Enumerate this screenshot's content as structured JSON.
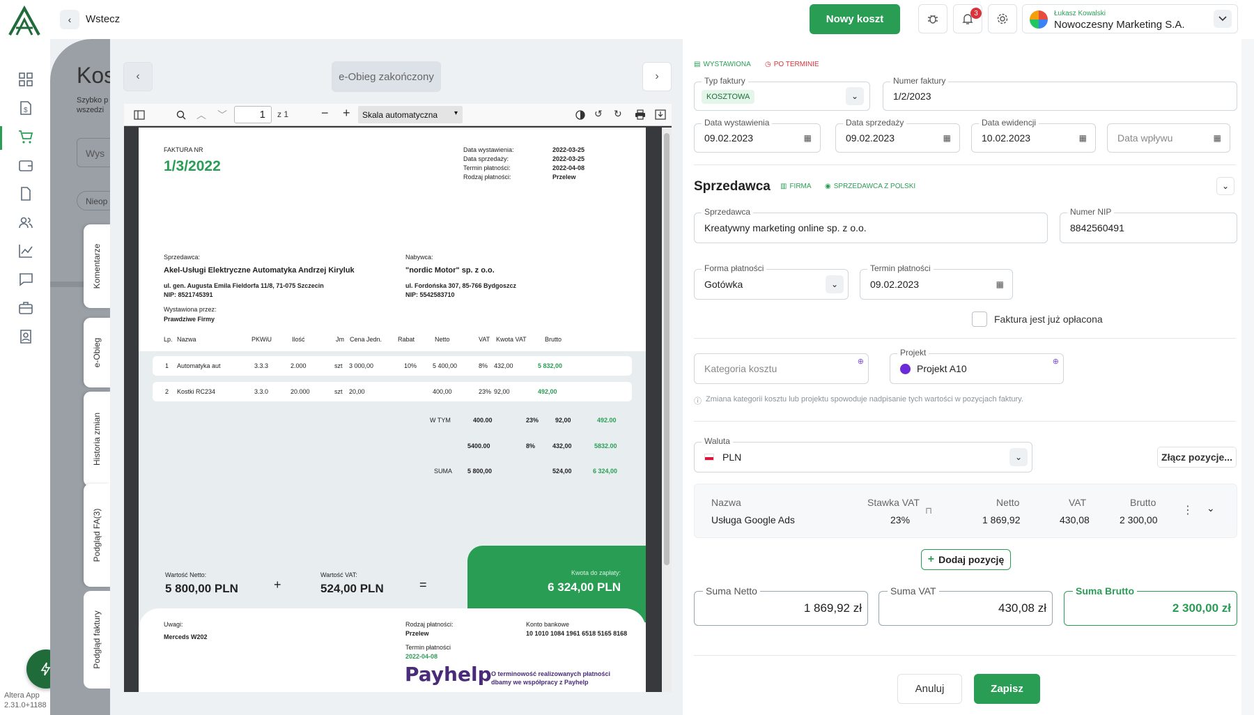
{
  "colors": {
    "accent": "#2a9d55",
    "danger": "#d9323a"
  },
  "topbar": {
    "back_label": "Wstecz",
    "new_cost_label": "Nowy koszt",
    "notif_count": "3",
    "company_user": "Łukasz Kowalski",
    "company_name": "Nowoczesny Marketing S.A."
  },
  "sidenav": {
    "icons": [
      "dashboard-icon",
      "finance-icon",
      "cart-icon",
      "wallet-icon",
      "document-icon",
      "users-icon",
      "chart-icon",
      "chat-icon",
      "briefcase-icon",
      "contact-icon"
    ],
    "active_index": 2
  },
  "bg": {
    "title": "Kos",
    "subtitle1": "Szybko p",
    "subtitle2": "wszedzi",
    "search_ph": "Wys",
    "filter_chip": "Nieop",
    "app_name": "Altera App",
    "version": "2.31.0+1188"
  },
  "vtabs": [
    "Komentarze",
    "e-Obieg",
    "Historia zmian",
    "Podgląd FA(3)",
    "Podgląd faktury"
  ],
  "viewer": {
    "status": "e-Obieg zakończony",
    "page": "1",
    "page_of": "z 1",
    "zoom": "Skala automatyczna"
  },
  "invoice": {
    "title_label": "FAKTURA NR",
    "number": "1/3/2022",
    "meta": [
      [
        "Data wystawienia:",
        "2022-03-25"
      ],
      [
        "Data sprzedaży:",
        "2022-03-25"
      ],
      [
        "Termin płatności:",
        "2022-04-08"
      ],
      [
        "Rodzaj płatności:",
        "Przelew"
      ]
    ],
    "seller_label": "Sprzedawca:",
    "seller_name": "Akel-Usługi Elektryczne Automatyka Andrzej Kiryluk",
    "seller_addr": "ul. gen. Augusta Emila Fieldorfa 11/8, 71-075 Szczecin",
    "seller_nip": "NIP: 8521745391",
    "issued_label": "Wystawiona przez:",
    "issued_by": "Prawdziwe Firmy",
    "buyer_label": "Nabywca:",
    "buyer_name": "\"nordic Motor\" sp. z o.o.",
    "buyer_addr": "ul. Fordońska 307, 85-766 Bydgoszcz",
    "buyer_nip": "NIP: 5542583710",
    "headers": [
      "Lp.",
      "Nazwa",
      "PKWiU",
      "Ilość",
      "Jm",
      "Cena Jedn.",
      "Rabat",
      "Netto",
      "VAT",
      "Kwota VAT",
      "Brutto"
    ],
    "rows": [
      [
        "1",
        "Automatyka aut",
        "3.3.3",
        "2.000",
        "szt",
        "3 000,00",
        "10%",
        "5 400,00",
        "8%",
        "432,00",
        "5 832,00"
      ],
      [
        "2",
        "Kostki RC234",
        "3.3.0",
        "20.000",
        "szt",
        "20,00",
        "",
        "400,00",
        "23%",
        "92,00",
        "492,00"
      ]
    ],
    "wtym_label": "W TYM",
    "sums": [
      [
        "400.00",
        "23%",
        "92,00",
        "492.00"
      ],
      [
        "5400.00",
        "8%",
        "432,00",
        "5832.00"
      ]
    ],
    "suma_label": "SUMA",
    "suma": [
      "5 800,00",
      "524,00",
      "6 324,00"
    ],
    "netto_label": "Wartość Netto:",
    "netto": "5 800,00 PLN",
    "vat_label": "Wartość VAT:",
    "vat": "524,00 PLN",
    "plus": "+",
    "eq": "=",
    "due_label": "Kwota do zapłaty:",
    "due": "6 324,00 PLN",
    "notes_label": "Uwagi:",
    "notes": "Merceds W202",
    "pay_label": "Rodzaj płatności:",
    "pay": "Przelew",
    "term_label": "Termin płatności",
    "term": "2022-04-08",
    "bank_label": "Konto bankowe",
    "bank": "10 1010 1084 1961 6518 5165 8168",
    "payhelp": "Payhelp",
    "payhelp_text1": "O terminowość realizowanych płatności",
    "payhelp_text2": "dbamy we współpracy z Payhelp"
  },
  "form": {
    "badge_issued": "WYSTAWIONA",
    "badge_overdue": "PO TERMINIE",
    "type_label": "Typ faktury",
    "type_value": "KOSZTOWA",
    "number_label": "Numer faktury",
    "number_value": "1/2/2023",
    "issue_label": "Data wystawienia",
    "issue_value": "09.02.2023",
    "sale_label": "Data sprzedaży",
    "sale_value": "09.02.2023",
    "record_label": "Data ewidencji",
    "record_value": "10.02.2023",
    "inflow_ph": "Data wpływu",
    "seller_section": "Sprzedawca",
    "tag_firm": "FIRMA",
    "tag_pl": "SPRZEDAWCA Z POLSKI",
    "seller_label": "Sprzedawca",
    "seller_value": "Kreatywny marketing online sp. z o.o.",
    "nip_label": "Numer NIP",
    "nip_value": "8842560491",
    "payform_label": "Forma płatności",
    "payform_value": "Gotówka",
    "payterm_label": "Termin płatności",
    "payterm_value": "09.02.2023",
    "paid_label": "Faktura jest już opłacona",
    "category_ph": "Kategoria kosztu",
    "project_label": "Projekt",
    "project_value": "Projekt A10",
    "info": "Zmiana kategorii kosztu lub projektu spowoduje nadpisanie tych wartości w pozycjach faktury.",
    "currency_label": "Waluta",
    "currency_value": "PLN",
    "merge_label": "Złącz pozycje...",
    "item_headers": [
      "Nazwa",
      "Stawka VAT",
      "Netto",
      "VAT",
      "Brutto"
    ],
    "item": [
      "Usługa Google Ads",
      "23%",
      "1 869,92",
      "430,08",
      "2 300,00"
    ],
    "add_item": "Dodaj pozycję",
    "sum_net_label": "Suma Netto",
    "sum_net": "1 869,92 zł",
    "sum_vat_label": "Suma VAT",
    "sum_vat": "430,08 zł",
    "sum_gross_label": "Suma Brutto",
    "sum_gross": "2 300,00 zł",
    "cancel": "Anuluj",
    "save": "Zapisz"
  }
}
